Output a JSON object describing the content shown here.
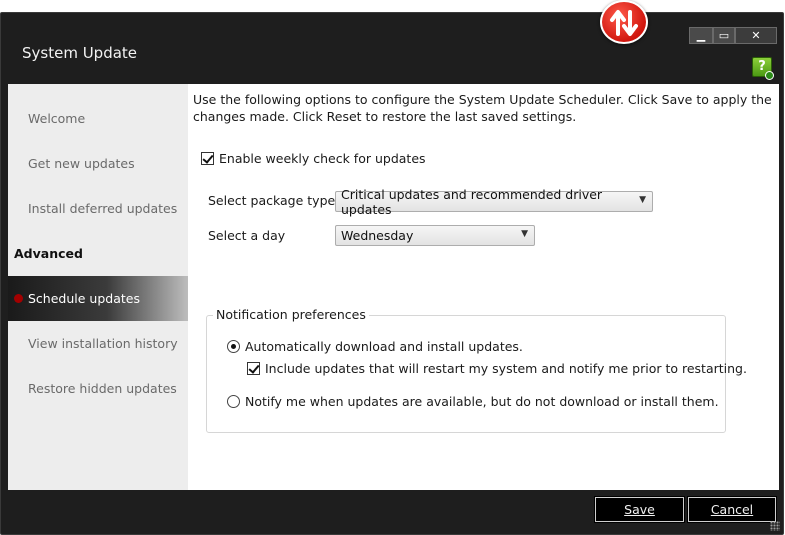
{
  "window": {
    "title": "System Update",
    "controls": {
      "minimize": "▁",
      "maximize": "▭",
      "close": "✕"
    },
    "help_icon": "?"
  },
  "sidebar": {
    "items": [
      {
        "label": "Welcome",
        "active": false
      },
      {
        "label": "Get new updates",
        "active": false
      },
      {
        "label": "Install deferred updates",
        "active": false
      },
      {
        "label": "Advanced",
        "header": true
      },
      {
        "label": "Schedule updates",
        "active": true
      },
      {
        "label": "View installation history",
        "active": false
      },
      {
        "label": "Restore hidden updates",
        "active": false
      }
    ]
  },
  "main": {
    "intro": "Use the following options to configure the System Update Scheduler. Click Save to apply the changes made. Click Reset to restore the last saved settings.",
    "weekly_check": {
      "label": "Enable weekly check for updates",
      "checked": true
    },
    "package_type": {
      "label": "Select package type:",
      "value": "Critical updates and recommended driver updates"
    },
    "day": {
      "label": "Select a day",
      "value": "Wednesday"
    },
    "notification": {
      "legend": "Notification preferences",
      "auto": {
        "label": "Automatically download and install updates.",
        "selected": true
      },
      "include_restart": {
        "label": "Include updates that will restart my system and notify me prior to restarting.",
        "checked": true
      },
      "notify_only": {
        "label": "Notify me when updates are available, but do not download or install them.",
        "selected": false
      }
    }
  },
  "footer": {
    "save_label": "Save",
    "cancel_label": "Cancel"
  },
  "colors": {
    "title_bar": "#1e1e1e",
    "sidebar": "#ededed",
    "active_dot": "#a30000",
    "logo": "#d0160e"
  }
}
